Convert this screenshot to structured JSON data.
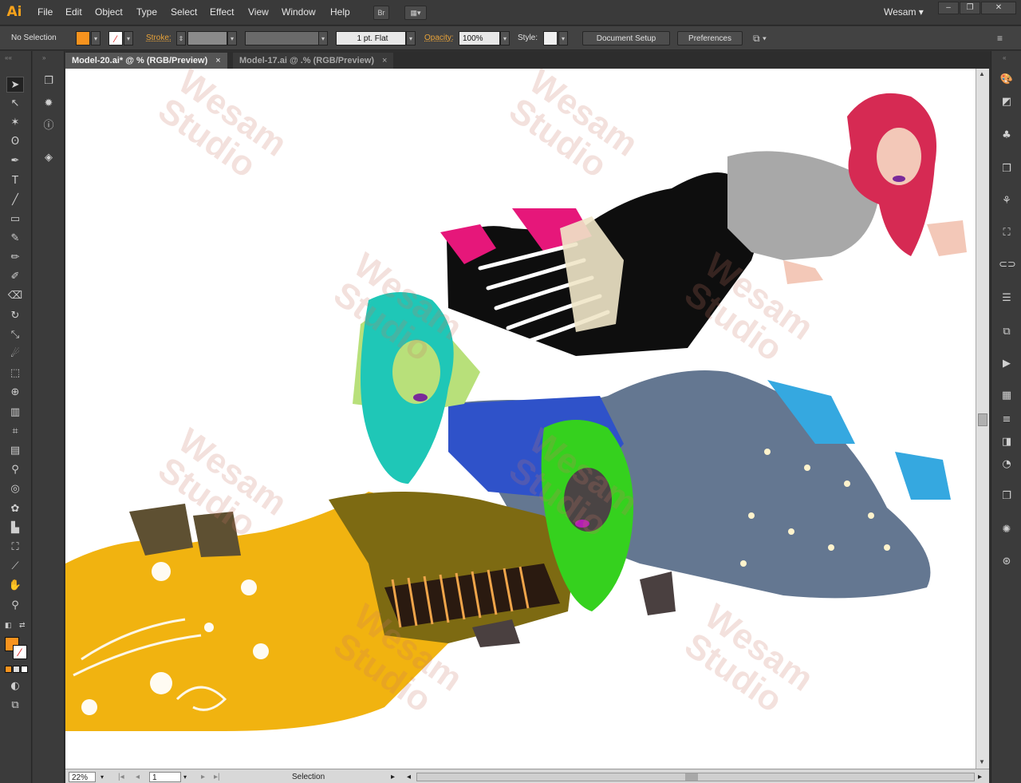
{
  "app": {
    "logo": "Ai"
  },
  "menu": [
    "File",
    "Edit",
    "Object",
    "Type",
    "Select",
    "Effect",
    "View",
    "Window",
    "Help"
  ],
  "bridge_label": "Br",
  "workspace": "Wesam",
  "window_buttons": {
    "minimize": "–",
    "restore": "❐",
    "close": "✕"
  },
  "control": {
    "selection_label": "No Selection",
    "fill_color": "#f7931e",
    "stroke_label": "Stroke:",
    "stroke_profile": "1 pt. Flat",
    "opacity_label": "Opacity:",
    "opacity_value": "100%",
    "style_label": "Style:",
    "document_setup": "Document Setup",
    "preferences": "Preferences"
  },
  "tabs": [
    {
      "label": "Model-20.ai* @ % (RGB/Preview)",
      "close": "×"
    },
    {
      "label": "Model-17.ai @ .% (RGB/Preview)",
      "close": "×"
    }
  ],
  "tools": [
    "selection-tool",
    "direct-selection-tool",
    "magic-wand-tool",
    "lasso-tool",
    "pen-tool",
    "type-tool",
    "line-tool",
    "rectangle-tool",
    "paintbrush-tool",
    "pencil-tool",
    "blob-brush-tool",
    "eraser-tool",
    "rotate-tool",
    "scale-tool",
    "warp-tool",
    "free-transform-tool",
    "shape-builder-tool",
    "perspective-grid-tool",
    "mesh-tool",
    "gradient-tool",
    "eyedropper-tool",
    "blend-tool",
    "symbol-sprayer-tool",
    "column-graph-tool",
    "artboard-tool",
    "slice-tool",
    "hand-tool",
    "zoom-tool"
  ],
  "status": {
    "zoom": "22%",
    "artboard": "1",
    "tool_name": "Selection"
  },
  "watermark": [
    "Wesam",
    "Studio"
  ],
  "colors": {
    "accent": "#f7931e",
    "ui_dark": "#3b3b3b",
    "canvas": "#ffffff"
  }
}
